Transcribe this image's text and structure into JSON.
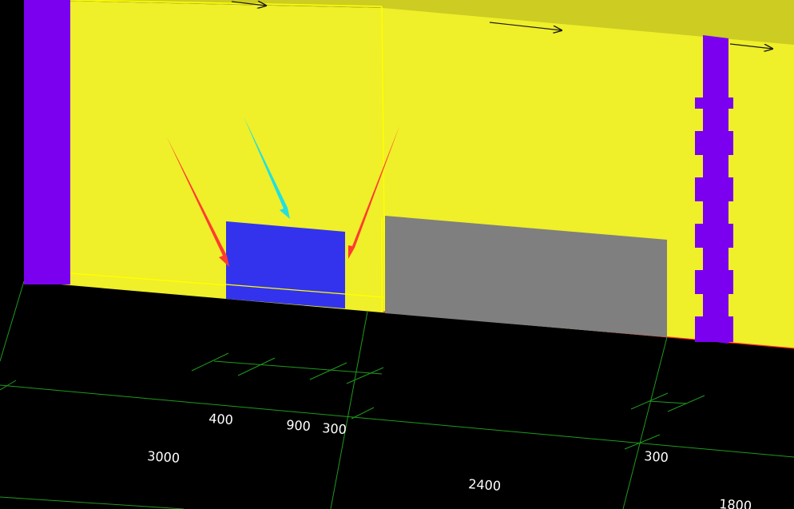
{
  "colors": {
    "background": "#000000",
    "wall_face": "#efef2a",
    "wall_top": "#cccc22",
    "wall_outline": "#ffff00",
    "column": "#7b00f0",
    "window": "#3333ee",
    "door": "#7f7f7f",
    "dimension_line": "#1f9a1f",
    "grid_red": "#ff2020",
    "arrow_red": "#ff3b30",
    "arrow_cyan": "#22e0e0",
    "direction_arrow": "#1a1a1a",
    "text": "#ffffff"
  },
  "scene": {
    "wall": {
      "name": "wall-segment"
    },
    "window": {
      "name": "window-opening"
    },
    "door": {
      "name": "door-opening"
    },
    "columns": [
      {
        "name": "column-left"
      },
      {
        "name": "column-right"
      }
    ],
    "callout_arrows": [
      {
        "name": "red-arrow-left",
        "color_key": "arrow_red"
      },
      {
        "name": "cyan-arrow-center",
        "color_key": "arrow_cyan"
      },
      {
        "name": "red-arrow-right",
        "color_key": "arrow_red"
      }
    ]
  },
  "dimensions": {
    "top_row": [
      {
        "name": "dim-400",
        "text": "400"
      },
      {
        "name": "dim-900",
        "text": "900"
      },
      {
        "name": "dim-300-a",
        "text": "300"
      },
      {
        "name": "dim-300-b",
        "text": "300"
      }
    ],
    "bottom_row": [
      {
        "name": "dim-3000",
        "text": "3000"
      },
      {
        "name": "dim-2400",
        "text": "2400"
      },
      {
        "name": "dim-1800",
        "text": "1800"
      }
    ]
  }
}
